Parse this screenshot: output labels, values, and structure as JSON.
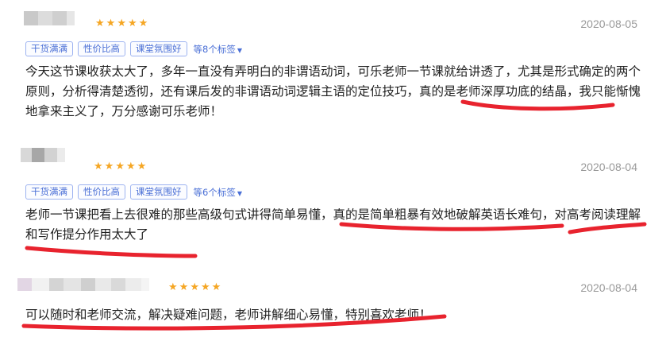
{
  "reviews": [
    {
      "date": "2020-08-05",
      "rating": 5,
      "tags": [
        "干货满满",
        "性价比高",
        "课堂氛围好"
      ],
      "more_tags": "等8个标签",
      "text": "今天这节课收获太大了，多年一直没有弄明白的非谓语动词，可乐老师一节课就给讲透了，尤其是形式确定的两个原则，分析得清楚透彻，还有课后发的非谓语动词逻辑主语的定位技巧，真的是老师深厚功底的结晶，我只能惭愧地拿来主义了，万分感谢可乐老师！"
    },
    {
      "date": "2020-08-04",
      "rating": 5,
      "tags": [
        "干货满满",
        "性价比高",
        "课堂氛围好"
      ],
      "more_tags": "等6个标签",
      "text": "老师一节课把看上去很难的那些高级句式讲得简单易懂，真的是简单粗暴有效地破解英语长难句，对高考阅读理解和写作提分作用太大了"
    },
    {
      "date": "2020-08-04",
      "rating": 5,
      "text": "可以随时和老师交流，解决疑难问题，老师讲解细心易懂，特别喜欢老师！"
    }
  ],
  "colors": {
    "star": "#f5a623",
    "tag": "#4a6fd6",
    "annotation": "#e8232e"
  }
}
